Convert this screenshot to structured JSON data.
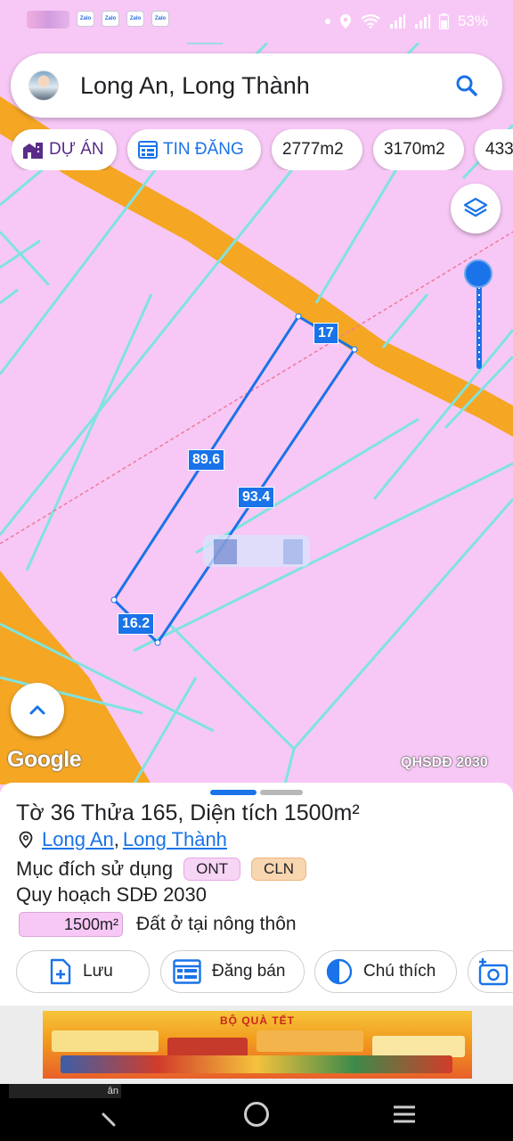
{
  "status_bar": {
    "battery": "53%",
    "icons": [
      "zalo-icon",
      "zalo-icon",
      "zalo-icon",
      "zalo-icon",
      "location-icon",
      "wifi-icon",
      "signal-icon",
      "signal-icon",
      "battery-icon"
    ]
  },
  "search": {
    "query": "Long An, Long Thành",
    "icon": "search-icon"
  },
  "chips": [
    {
      "label": "DỰ ÁN",
      "icon": "building-icon"
    },
    {
      "label": "TIN ĐĂNG",
      "icon": "listing-icon"
    },
    {
      "label": "2777m2"
    },
    {
      "label": "3170m2"
    },
    {
      "label": "433"
    }
  ],
  "map": {
    "edges": [
      "17",
      "89.6",
      "93.4",
      "16.2"
    ],
    "attribution": "Google",
    "overlay_tag": "QHSDĐ 2030",
    "colors": {
      "residential": "#f7c8f5",
      "road": "#f5a623",
      "boundary": "#1a73e8",
      "grid": "#7fe3e0"
    }
  },
  "sheet": {
    "title": "Tờ 36 Thửa 165, Diện tích 1500m²",
    "province": "Long An",
    "separator": ",",
    "district": "Long Thành",
    "purpose_label": "Mục đích sử dụng",
    "tags": [
      "ONT",
      "CLN"
    ],
    "plan_label": "Quy hoạch SDĐ 2030",
    "area_value": "1500m²",
    "area_desc": "Đất ở tại nông thôn",
    "actions": [
      {
        "label": "Lưu",
        "icon": "save-add-icon"
      },
      {
        "label": "Đăng bán",
        "icon": "listing-icon"
      },
      {
        "label": "Chú thích",
        "icon": "contrast-icon"
      },
      {
        "label": "",
        "icon": "camera-add-icon"
      }
    ]
  },
  "ad": {
    "headline": "BỘ QUÀ TẾT"
  },
  "nav_bar": {
    "mini_text": "ân"
  }
}
